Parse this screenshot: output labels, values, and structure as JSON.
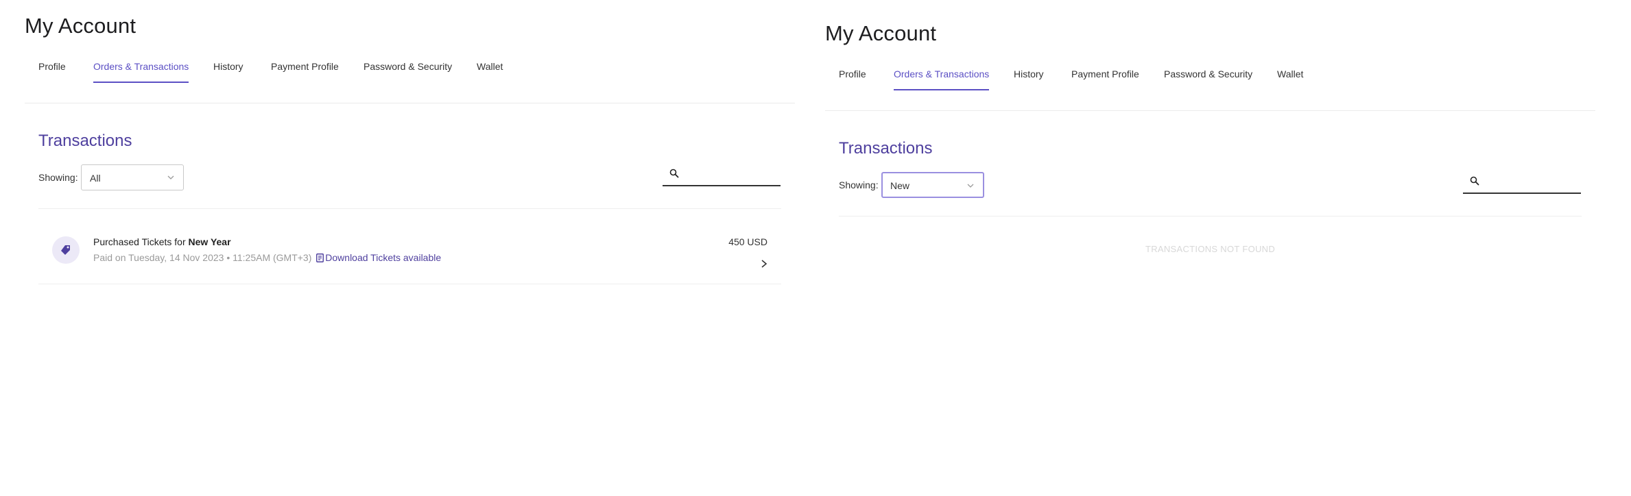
{
  "screens": [
    {
      "page_title": "My Account",
      "tabs": [
        {
          "label": "Profile",
          "active": false
        },
        {
          "label": "Orders & Transactions",
          "active": true
        },
        {
          "label": "History",
          "active": false
        },
        {
          "label": "Payment Profile",
          "active": false
        },
        {
          "label": "Password & Security",
          "active": false
        },
        {
          "label": "Wallet",
          "active": false
        }
      ],
      "section_title": "Transactions",
      "filter": {
        "label": "Showing:",
        "selected": "All"
      },
      "search": {
        "placeholder": "",
        "value": ""
      },
      "transactions": [
        {
          "title_prefix": "Purchased Tickets for",
          "event_name": "New Year",
          "paid_info": "Paid on Tuesday, 14 Nov 2023 • 11:25AM (GMT+3)",
          "download_label": "Download Tickets available",
          "amount": "450 USD"
        }
      ]
    },
    {
      "page_title": "My Account",
      "tabs": [
        {
          "label": "Profile",
          "active": false
        },
        {
          "label": "Orders & Transactions",
          "active": true
        },
        {
          "label": "History",
          "active": false
        },
        {
          "label": "Payment Profile",
          "active": false
        },
        {
          "label": "Password & Security",
          "active": false
        },
        {
          "label": "Wallet",
          "active": false
        }
      ],
      "section_title": "Transactions",
      "filter": {
        "label": "Showing:",
        "selected": "New"
      },
      "search": {
        "placeholder": "",
        "value": ""
      },
      "empty_message": "TRANSACTIONS NOT FOUND"
    }
  ],
  "colors": {
    "accent": "#5b4fc4",
    "section_title": "#4e3f9e",
    "muted_text": "#9a9a9a",
    "empty_text": "#d8d8d8",
    "avatar_bg": "#ece9f7"
  },
  "icons": {
    "tag": "tag-icon",
    "search": "search-icon",
    "chevron": "chevron-down-icon",
    "arrow": "chevron-right-icon",
    "document": "document-icon"
  }
}
